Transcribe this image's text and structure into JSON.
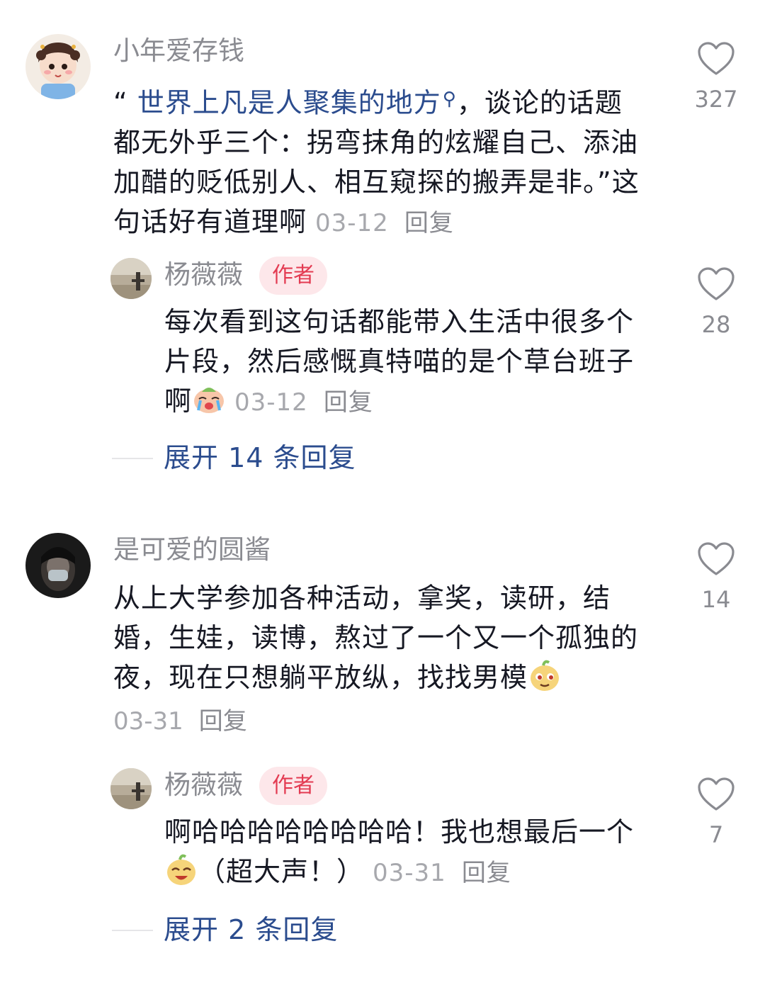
{
  "colors": {
    "accent_link": "#2b4c8e",
    "author_badge_bg": "#fde7ea",
    "author_badge_text": "#e33b52",
    "muted_text": "#8a8b91",
    "body_text": "#161823"
  },
  "comments": [
    {
      "username": "小年爱存钱",
      "text_prefix": "“ ",
      "highlight": "世界上凡是人聚集的地方",
      "text_rest": "，谈论的话题都无外乎三个：拐弯抹角的炫耀自己、添油加醋的贬低别人、相互窥探的搬弄是非。”这句话好有道理啊",
      "date": "03-12",
      "reply_label": "回复",
      "likes": "327",
      "reply": {
        "username": "杨薇薇",
        "badge": "作者",
        "text": "每次看到这句话都能带入生活中很多个片段，然后感慨真特喵的是个草台班子啊",
        "emoji": "crying-face-emoji",
        "date": "03-12",
        "reply_label": "回复",
        "likes": "28"
      },
      "expand_label": "展开 14 条回复"
    },
    {
      "username": "是可爱的圆酱",
      "text": "从上大学参加各种活动，拿奖，读研，结婚，生娃，读博，熬过了一个又一个孤独的夜，现在只想躺平放纵，找找男模",
      "emoji": "smirk-pear-emoji",
      "date": "03-31",
      "reply_label": "回复",
      "likes": "14",
      "reply": {
        "username": "杨薇薇",
        "badge": "作者",
        "text_before_emoji": "啊哈哈哈哈哈哈哈哈！我也想最后一个",
        "emoji": "laughing-pear-emoji",
        "text_after_emoji": "（超大声！）",
        "date": "03-31",
        "reply_label": "回复",
        "likes": "7"
      },
      "expand_label": "展开 2 条回复"
    }
  ]
}
